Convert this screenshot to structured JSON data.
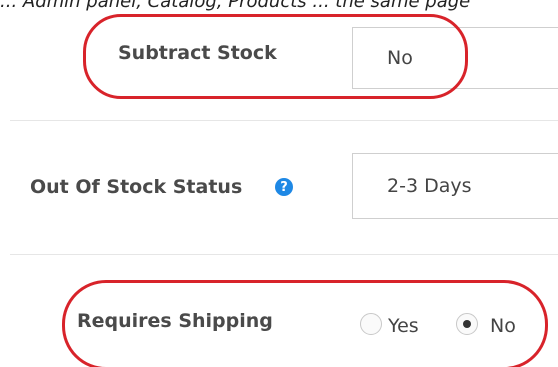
{
  "top_text": "... Admin panel, Catalog, Products ... the same page",
  "subtract_stock": {
    "label": "Subtract Stock",
    "value": "No"
  },
  "out_of_stock_status": {
    "label": "Out Of Stock Status",
    "value": "2-3 Days",
    "help_icon": "question-circle-icon"
  },
  "requires_shipping": {
    "label": "Requires Shipping",
    "options": [
      {
        "label": "Yes",
        "selected": false
      },
      {
        "label": "No",
        "selected": true
      }
    ]
  },
  "colors": {
    "highlight": "#d8232a",
    "help_icon": "#1e88e5",
    "label_text": "#4a4a4a",
    "field_border": "#cfcfcf"
  }
}
